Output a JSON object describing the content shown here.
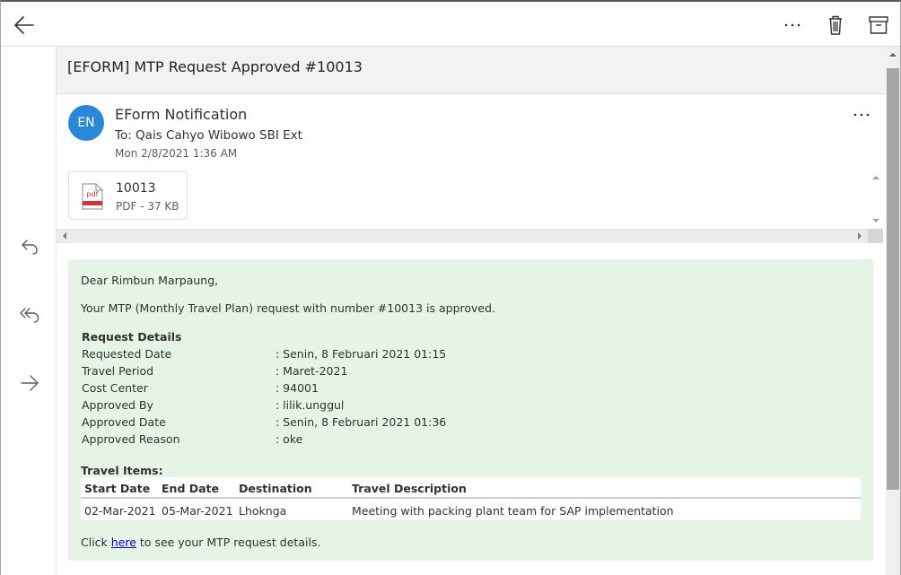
{
  "message": {
    "subject": "[EFORM] MTP Request Approved #10013",
    "sender": {
      "initials": "EN",
      "name": "EForm Notification",
      "to": "To: Qais Cahyo Wibowo SBI Ext",
      "date": "Mon 2/8/2021 1:36 AM",
      "avatar_color": "#2b88d8"
    },
    "attachment": {
      "icon_label": "pdf",
      "name": "10013",
      "meta": "PDF - 37 KB"
    }
  },
  "body": {
    "background": "#e6f4e6",
    "greeting": "Dear Rimbun Marpaung,",
    "intro": "Your MTP (Monthly Travel Plan) request with number #10013 is approved.",
    "details_heading": "Request Details",
    "details": [
      {
        "label": "Requested Date",
        "value": ": Senin, 8 Februari 2021 01:15"
      },
      {
        "label": "Travel Period",
        "value": ": Maret-2021"
      },
      {
        "label": "Cost Center",
        "value": ": 94001"
      },
      {
        "label": "Approved By",
        "value": ": lilik.unggul"
      },
      {
        "label": "Approved Date",
        "value": ": Senin, 8 Februari 2021 01:36"
      },
      {
        "label": "Approved Reason",
        "value": ": oke"
      }
    ],
    "items_heading": "Travel Items:",
    "items_columns": [
      "Start Date",
      "End Date",
      "Destination",
      "Travel Description"
    ],
    "items_rows": [
      [
        "02-Mar-2021",
        "05-Mar-2021",
        "Lhoknga",
        "Meeting with packing plant team for SAP implementation"
      ]
    ],
    "footer_prefix": "Click ",
    "footer_link": "here",
    "footer_suffix": " to see your MTP request details."
  },
  "icons": {
    "back": "arrow-left-icon",
    "more": "more-horizontal-icon",
    "trash": "trash-icon",
    "archive": "archive-icon",
    "reply": "reply-icon",
    "reply_all": "reply-all-icon",
    "forward": "forward-icon"
  }
}
